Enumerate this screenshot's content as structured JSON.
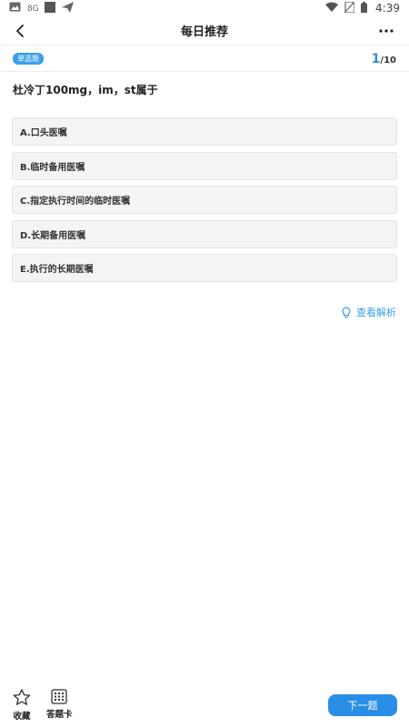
{
  "status_bar": {
    "time": "4:39",
    "icons": [
      "image-icon",
      "sim-icon",
      "square-app-icon",
      "send-icon",
      "wifi-icon",
      "no-sim-icon",
      "battery-icon"
    ]
  },
  "nav": {
    "title": "每日推荐"
  },
  "question_header": {
    "type_badge": "单选题",
    "current": "1",
    "total": "/10"
  },
  "question": {
    "text": "杜冷丁100mg，im，st属于"
  },
  "options": [
    {
      "label": "A.口头医嘱"
    },
    {
      "label": "B.临时备用医嘱"
    },
    {
      "label": "C.指定执行时间的临时医嘱"
    },
    {
      "label": "D.长期备用医嘱"
    },
    {
      "label": "E.执行的长期医嘱"
    }
  ],
  "analysis": {
    "label": "查看解析"
  },
  "bottom_bar": {
    "favorite_label": "收藏",
    "answer_card_label": "答题卡",
    "next_label": "下一题"
  },
  "colors": {
    "accent": "#2a8ee6",
    "badge": "#3aa0e8",
    "option_bg": "#f4f4f4"
  }
}
